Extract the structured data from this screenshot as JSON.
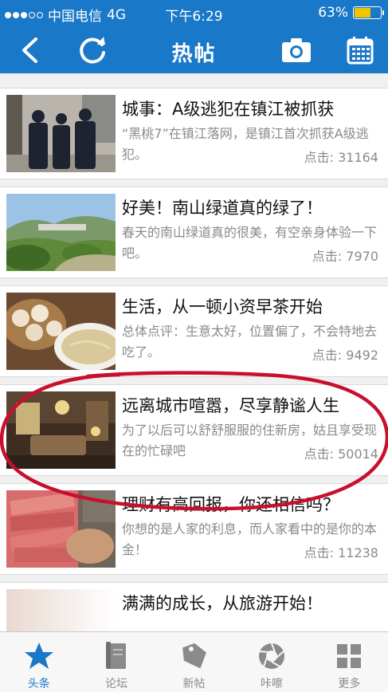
{
  "status_bar": {
    "carrier": "中国电信",
    "network": "4G",
    "time": "下午6:29",
    "battery_text": "63%",
    "battery_level": 0.63,
    "signal_bars_filled": 3,
    "signal_bars_total": 5
  },
  "nav": {
    "title": "热帖",
    "back_icon": "chevron-left-icon",
    "refresh_icon": "refresh-icon",
    "camera_icon": "camera-icon",
    "calendar_icon": "calendar-icon"
  },
  "posts": [
    {
      "title": "城事：A级逃犯在镇江被抓获",
      "summary": "“黑桃7”在镇江落网，是镇江首次抓获A级逃犯。",
      "clicks": "点击: 31164"
    },
    {
      "title": "好美！南山绿道真的绿了！",
      "summary": "春天的南山绿道真的很美，有空亲身体验一下吧。",
      "clicks": "点击: 7970"
    },
    {
      "title": "生活，从一顿小资早茶开始",
      "summary": "总体点评：生意太好，位置偏了，不会特地去吃了。",
      "clicks": "点击: 9492"
    },
    {
      "title": "远离城市喧嚣，尽享静谧人生",
      "summary": "为了以后可以舒舒服服的住新房，姑且享受现在的忙碌吧",
      "clicks": "点击: 50014"
    },
    {
      "title": "理财有高回报，你还相信吗？",
      "summary": "你想的是人家的利息，而人家看中的是你的本金！",
      "clicks": "点击: 11238"
    },
    {
      "title": "满满的成长，从旅游开始！",
      "summary": "",
      "clicks": ""
    }
  ],
  "tabs": [
    {
      "label": "头条",
      "icon": "star-icon",
      "active": true
    },
    {
      "label": "论坛",
      "icon": "book-icon",
      "active": false
    },
    {
      "label": "新帖",
      "icon": "tag-icon",
      "active": false
    },
    {
      "label": "咔嚓",
      "icon": "aperture-icon",
      "active": false
    },
    {
      "label": "更多",
      "icon": "grid-icon",
      "active": false
    }
  ],
  "colors": {
    "brand_blue": "#1a78c8",
    "annotation_red": "#c8102e",
    "battery_yellow": "#f5c400"
  }
}
